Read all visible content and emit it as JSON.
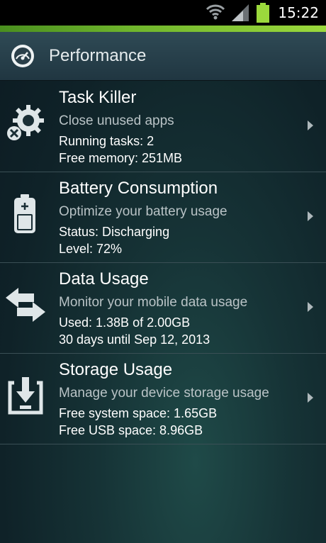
{
  "status_bar": {
    "time": "15:22",
    "icons": [
      "wifi-icon",
      "signal-icon",
      "battery-icon"
    ]
  },
  "colors": {
    "accent_green": "#6fb52c",
    "battery_green": "#9bd93c"
  },
  "header": {
    "title": "Performance",
    "back_glyph": "〈",
    "app_icon": "speedometer-icon"
  },
  "items": [
    {
      "title": "Task Killer",
      "subtitle": "Close unused apps",
      "line1": "Running tasks: 2",
      "line2": "Free memory: 251MB",
      "icon": "gear-close-icon"
    },
    {
      "title": "Battery Consumption",
      "subtitle": "Optimize your battery usage",
      "line1": "Status: Discharging",
      "line2": "Level: 72%",
      "icon": "battery-icon"
    },
    {
      "title": "Data Usage",
      "subtitle": "Monitor your mobile data usage",
      "line1": "Used: 1.38B of 2.00GB",
      "line2": "30 days until Sep 12, 2013",
      "icon": "transfer-arrows-icon"
    },
    {
      "title": "Storage Usage",
      "subtitle": "Manage your device storage usage",
      "line1": "Free system space: 1.65GB",
      "line2": "Free USB space: 8.96GB",
      "icon": "storage-download-icon"
    }
  ]
}
